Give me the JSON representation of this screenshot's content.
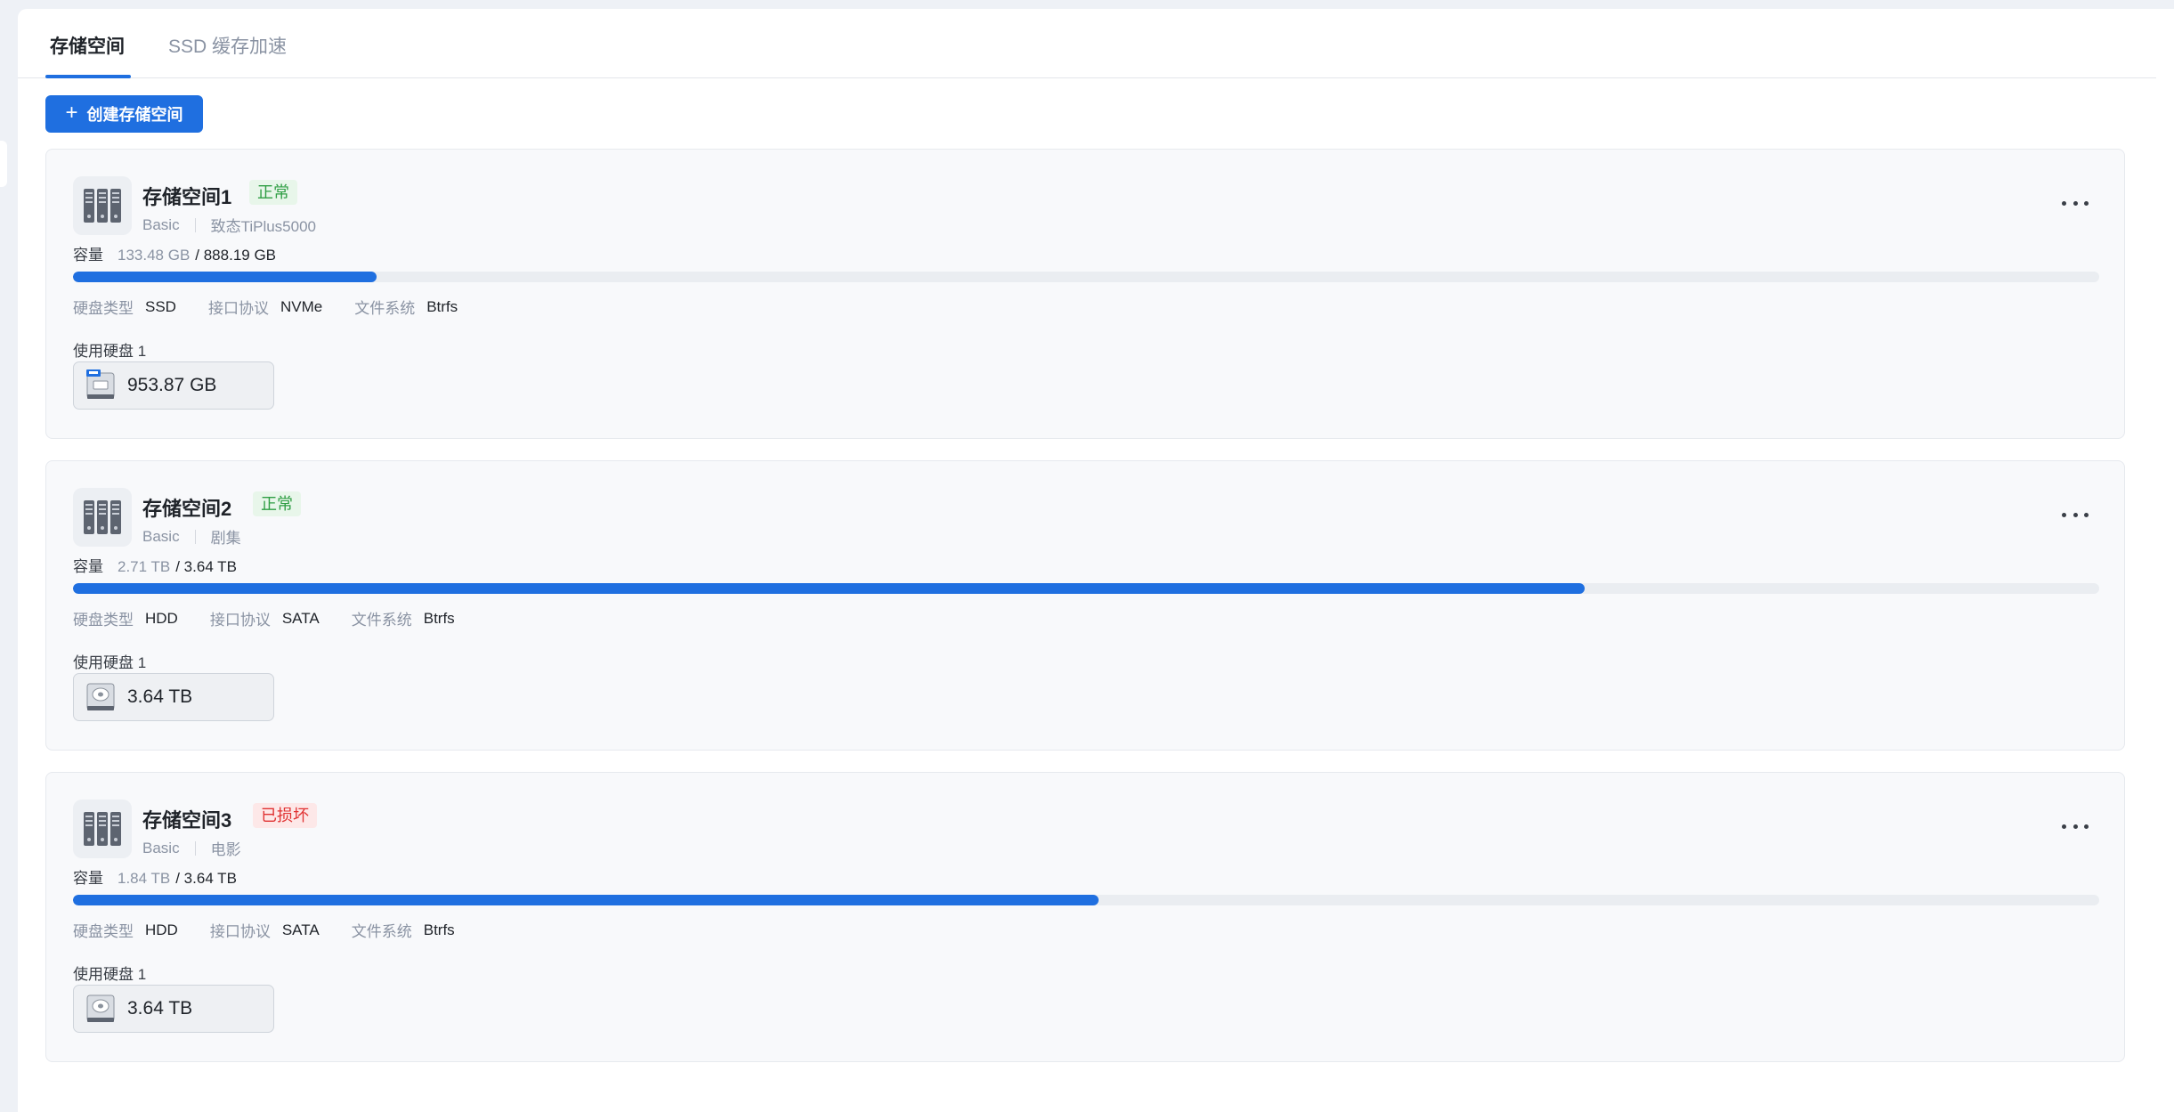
{
  "tabs": [
    {
      "label": "存储空间",
      "active": true
    },
    {
      "label": "SSD 缓存加速",
      "active": false
    }
  ],
  "create_button": {
    "label": "创建存储空间",
    "icon": "plus-icon"
  },
  "labels": {
    "capacity": "容量",
    "disk_type": "硬盘类型",
    "protocol": "接口协议",
    "filesystem": "文件系统"
  },
  "colors": {
    "accent": "#1f6fe0",
    "ok": "#2f9e44",
    "error": "#e03131"
  },
  "pools": [
    {
      "name": "存储空间1",
      "status": "正常",
      "status_type": "ok",
      "raid": "Basic",
      "description": "致态TiPlus5000",
      "used": "133.48 GB",
      "total": "/ 888.19 GB",
      "usage_fraction": 0.15,
      "disk_type": "SSD",
      "protocol": "NVMe",
      "filesystem": "Btrfs",
      "disks_label": "使用硬盘 1",
      "disk_icon": "nvme-ssd-icon",
      "disk_size": "953.87 GB"
    },
    {
      "name": "存储空间2",
      "status": "正常",
      "status_type": "ok",
      "raid": "Basic",
      "description": "剧集",
      "used": "2.71 TB",
      "total": "/ 3.64 TB",
      "usage_fraction": 0.746,
      "disk_type": "HDD",
      "protocol": "SATA",
      "filesystem": "Btrfs",
      "disks_label": "使用硬盘 1",
      "disk_icon": "hdd-icon",
      "disk_size": "3.64 TB"
    },
    {
      "name": "存储空间3",
      "status": "已损坏",
      "status_type": "bad",
      "raid": "Basic",
      "description": "电影",
      "used": "1.84 TB",
      "total": "/ 3.64 TB",
      "usage_fraction": 0.506,
      "disk_type": "HDD",
      "protocol": "SATA",
      "filesystem": "Btrfs",
      "disks_label": "使用硬盘 1",
      "disk_icon": "hdd-icon",
      "disk_size": "3.64 TB"
    }
  ]
}
